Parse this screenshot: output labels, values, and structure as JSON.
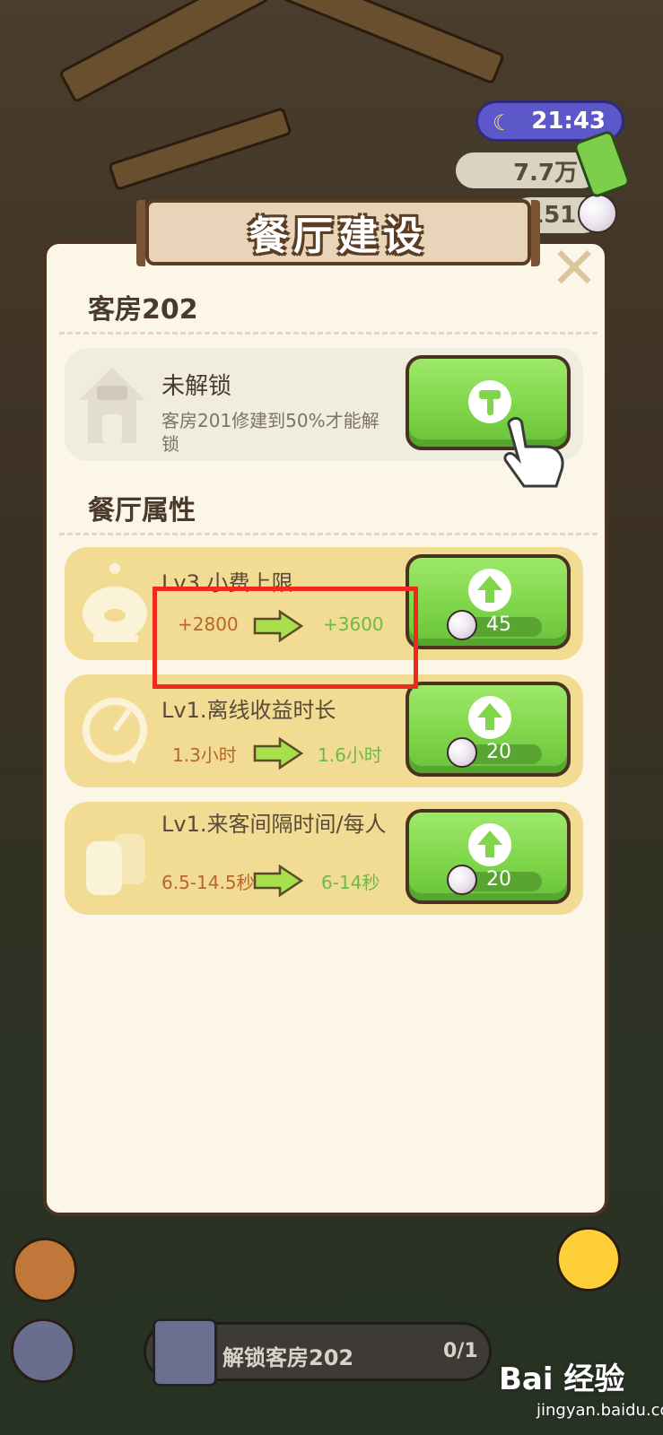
{
  "hud": {
    "time": "21:43",
    "money": "7.7万",
    "pearls": "151"
  },
  "dialog": {
    "title": "餐厅建设",
    "close_label": "✕"
  },
  "room": {
    "section_title": "客房202",
    "locked_title": "未解锁",
    "locked_desc": "客房201修建到50%才能解锁"
  },
  "attributes": {
    "section_title": "餐厅属性",
    "items": [
      {
        "title": "Lv3.小费上限",
        "from": "+2800",
        "to": "+3600",
        "cost": "45"
      },
      {
        "title": "Lv1.离线收益时长",
        "from": "1.3小时",
        "to": "1.6小时",
        "cost": "20"
      },
      {
        "title": "Lv1.来客间隔时间/每人",
        "from": "6.5-14.5秒",
        "to": "6-14秒",
        "cost": "20"
      }
    ]
  },
  "bottom": {
    "label": "解锁客房202",
    "count": "0/1"
  },
  "watermark": {
    "main": "Bai 经验",
    "sub": "jingyan.baidu.com"
  },
  "colors": {
    "button_green": "#7fd64a",
    "card_yellow": "#f2dc93",
    "highlight_red": "#ee2a1b"
  }
}
